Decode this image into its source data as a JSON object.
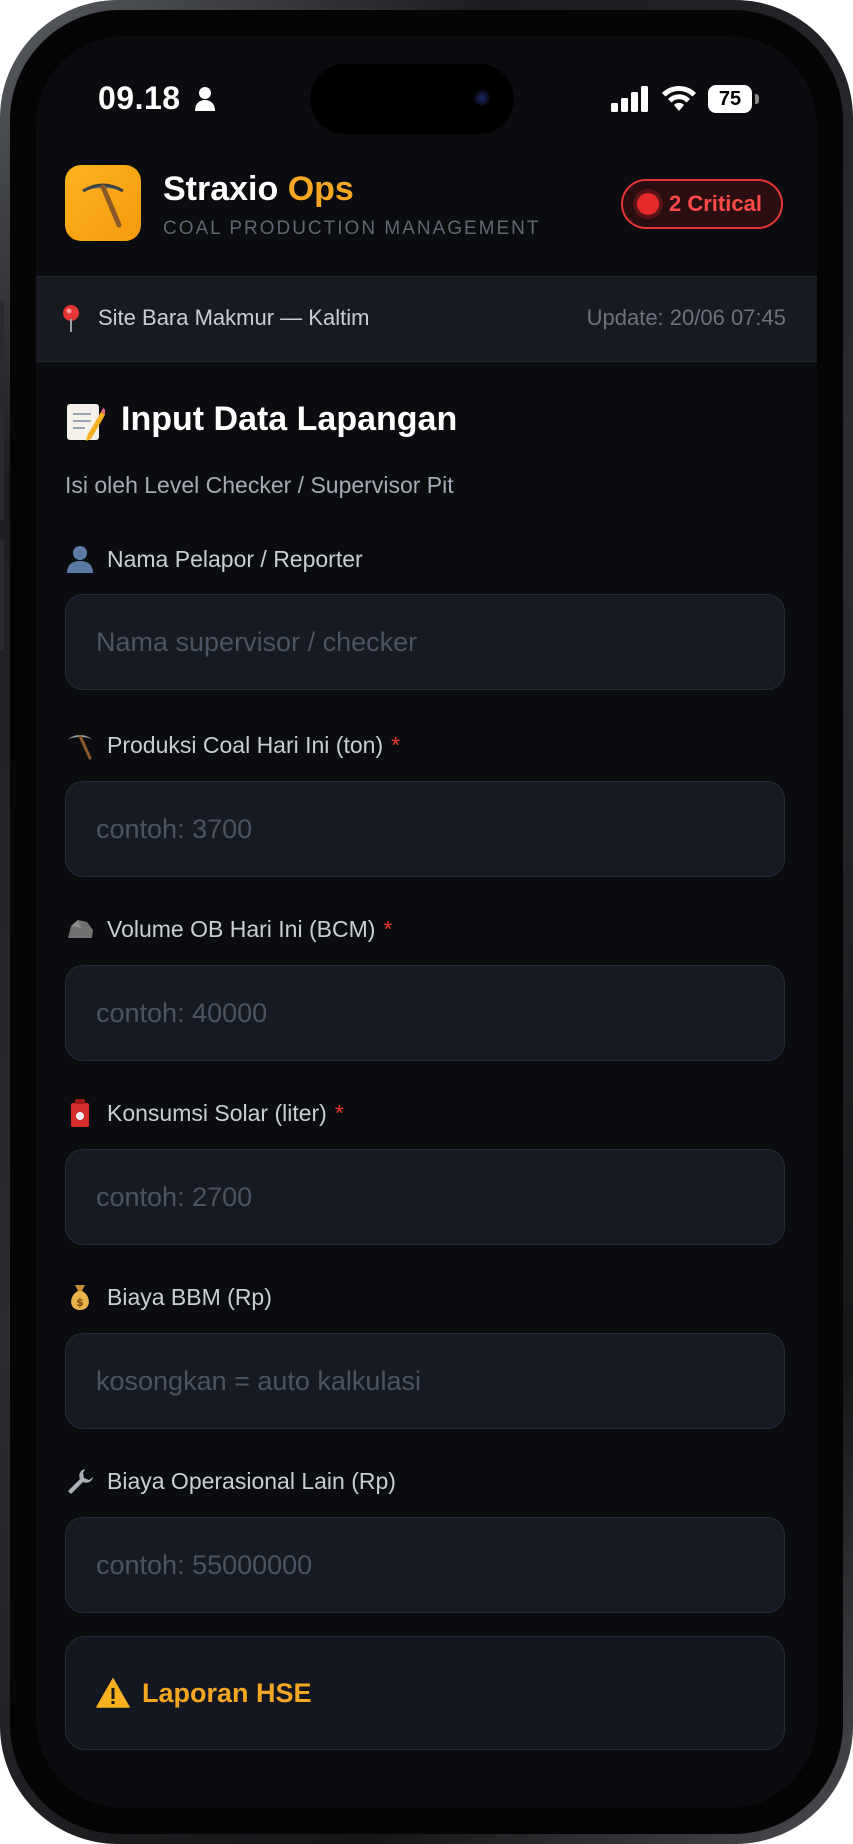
{
  "status_bar": {
    "time": "09.18",
    "battery": "75"
  },
  "header": {
    "title_main": "Straxio",
    "title_accent": "Ops",
    "subtitle": "COAL PRODUCTION MANAGEMENT",
    "critical_badge": "2 Critical"
  },
  "site": {
    "name": "Site Bara Makmur — Kaltim",
    "update": "Update: 20/06 07:45"
  },
  "section": {
    "title": "Input Data Lapangan",
    "subtitle": "Isi oleh Level Checker / Supervisor Pit"
  },
  "fields": [
    {
      "label": "Nama Pelapor / Reporter",
      "placeholder": "Nama supervisor / checker",
      "required": false,
      "icon": "person-icon"
    },
    {
      "label": "Produksi Coal Hari Ini (ton)",
      "placeholder": "contoh: 3700",
      "required": true,
      "icon": "pickaxe-icon"
    },
    {
      "label": "Volume OB Hari Ini (BCM)",
      "placeholder": "contoh: 40000",
      "required": true,
      "icon": "rock-icon"
    },
    {
      "label": "Konsumsi Solar (liter)",
      "placeholder": "contoh: 2700",
      "required": true,
      "icon": "fuel-icon"
    },
    {
      "label": "Biaya BBM (Rp)",
      "placeholder": "kosongkan = auto kalkulasi",
      "required": false,
      "icon": "money-bag-icon"
    },
    {
      "label": "Biaya Operasional Lain (Rp)",
      "placeholder": "contoh: 55000000",
      "required": false,
      "icon": "wrench-icon"
    }
  ],
  "required_marker": "*",
  "hse": {
    "label": "Laporan HSE"
  },
  "colors": {
    "accent": "#f5a623",
    "critical": "#e53535",
    "background": "#0b0c0f",
    "input_bg": "#151a23"
  }
}
